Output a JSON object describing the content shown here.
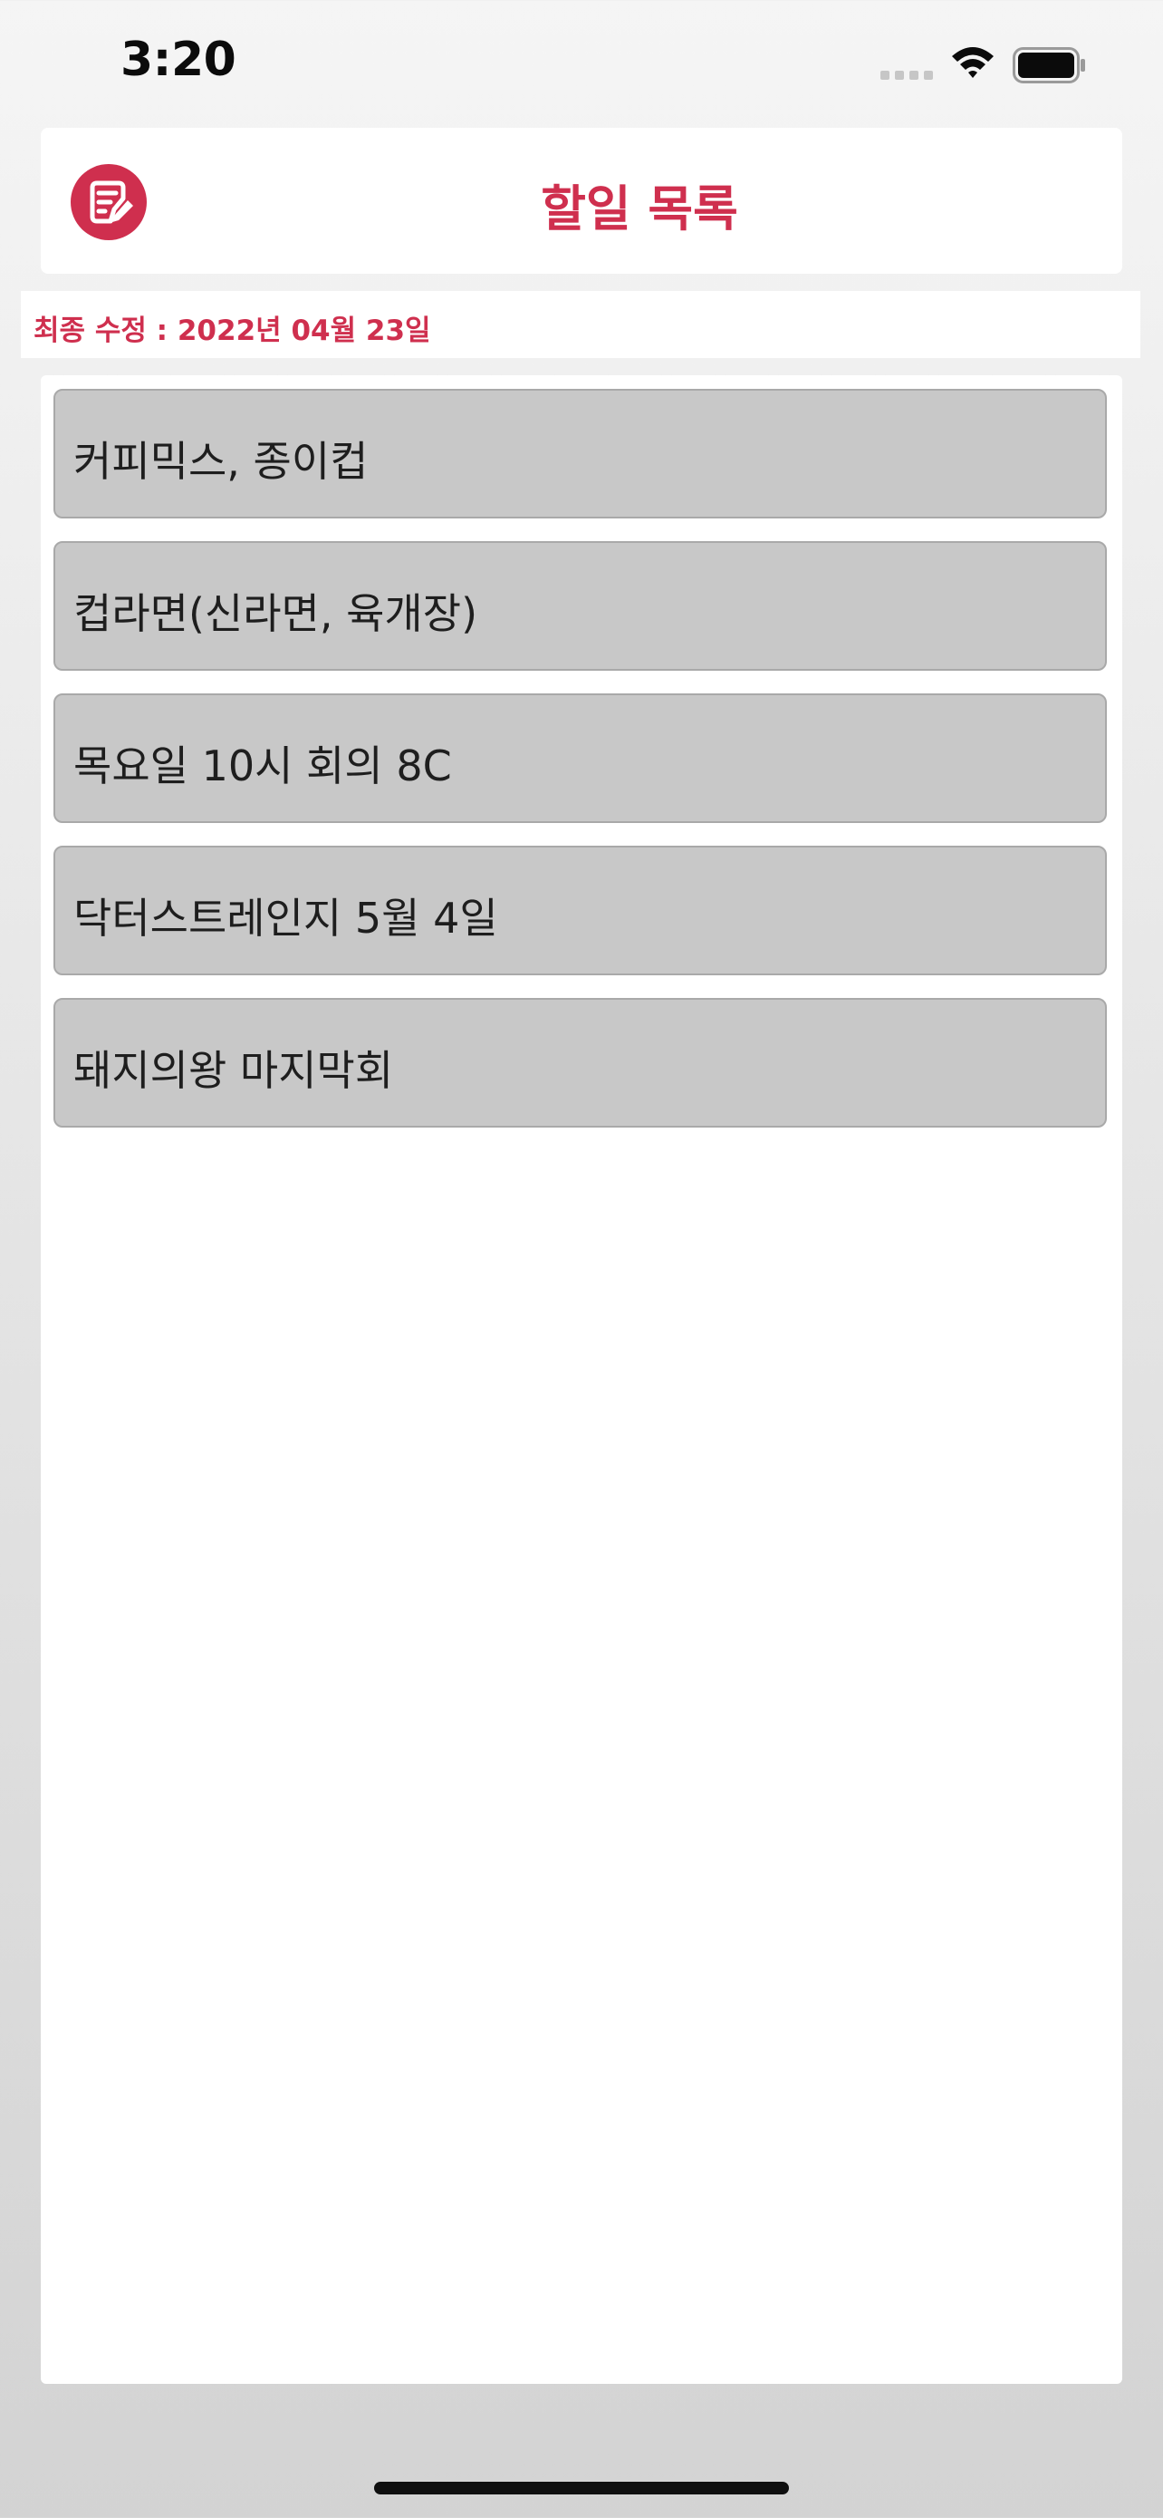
{
  "status_bar": {
    "time": "3:20",
    "signal_icon": "cellular-signal-icon",
    "wifi_icon": "wifi-icon",
    "battery_icon": "battery-full-icon"
  },
  "header": {
    "app_icon": "edit-note-icon",
    "title": "할일 목록"
  },
  "last_modified": {
    "text": "최종 수정 : 2022년 04월 23일"
  },
  "todos": [
    {
      "label": "커피믹스, 종이컵"
    },
    {
      "label": "컵라면(신라면, 육개장)"
    },
    {
      "label": "목요일 10시 회의 8C"
    },
    {
      "label": "닥터스트레인지 5월 4일"
    },
    {
      "label": "돼지의왕 마지막회"
    }
  ],
  "colors": {
    "accent": "#cf2f4e",
    "item_background": "#c8c8c8"
  }
}
